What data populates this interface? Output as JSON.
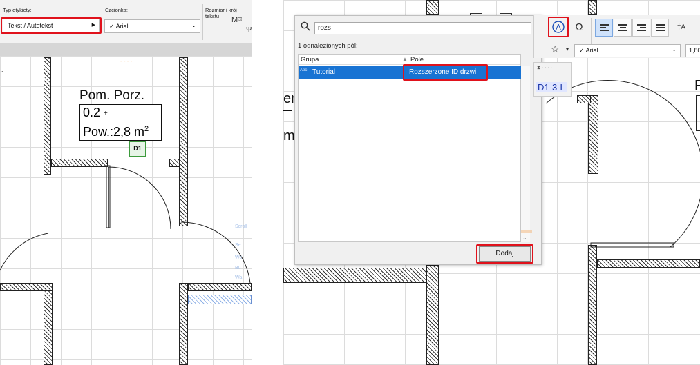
{
  "left": {
    "toolbar": {
      "label_type_caption": "Typ etykiety:",
      "label_type_value": "Tekst / Autotekst",
      "font_caption": "Czcionka:",
      "font_value": "Arial",
      "size_caption": "Rozmiar i krój tekstu"
    },
    "room": {
      "name": "Pom. Porz.",
      "number": "0.2",
      "area_label": "Pow.:2,8 m",
      "area_sup": "2",
      "door_marker": "D1"
    },
    "faded_labels": [
      "- - - -",
      "Scroll",
      "Se",
      "We",
      "Bu",
      "Wa"
    ]
  },
  "right": {
    "dialog": {
      "search_value": "rozs",
      "result_count": "1 odnalezionych pól:",
      "col_group": "Grupa",
      "col_field": "Pole",
      "rows": [
        {
          "group": "Tutorial",
          "field": "Rozszerzone ID drzwi"
        }
      ],
      "add_button": "Dodaj"
    },
    "toolbar": {
      "font_value": "Arial",
      "size_value": "1,80",
      "marker_text": "D1-3-L"
    },
    "fragments": {
      "en": "en",
      "m": "m",
      "p": "P"
    }
  },
  "colors": {
    "highlight_red": "#e0121c",
    "selection_blue": "#1873d3",
    "marker_blue": "#1a35a8"
  }
}
